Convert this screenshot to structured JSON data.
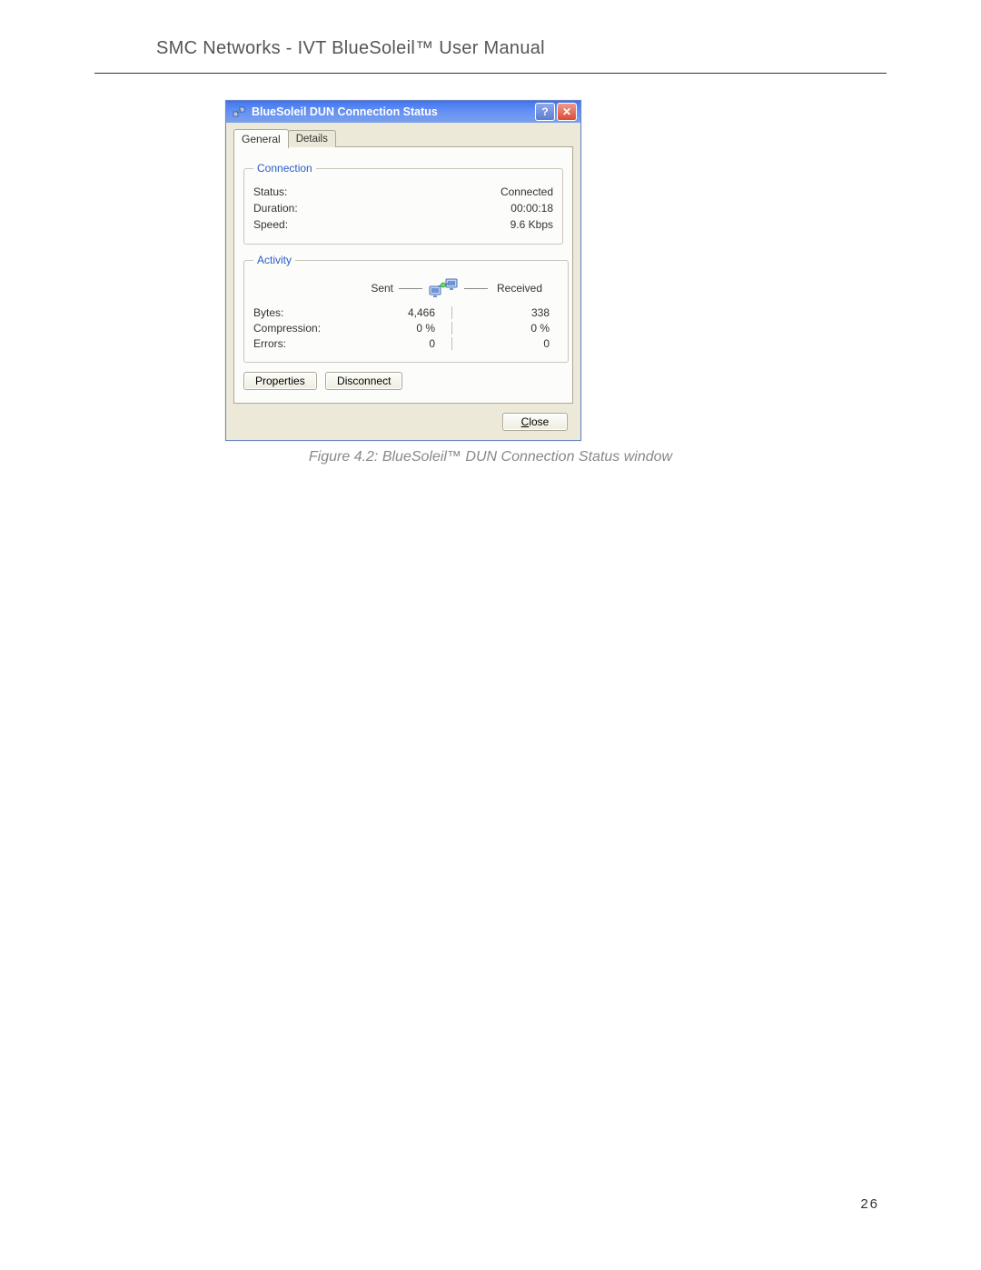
{
  "page": {
    "header_text": "SMC Networks - IVT BlueSoleil™ User Manual",
    "page_number": "26",
    "figure_caption": "Figure 4.2: BlueSoleil™ DUN Connection Status window"
  },
  "dialog": {
    "title": "BlueSoleil DUN Connection Status",
    "help_glyph": "?",
    "close_glyph": "✕",
    "tabs": {
      "general": "General",
      "details": "Details"
    },
    "connection": {
      "legend": "Connection",
      "status_label": "Status:",
      "status_value": "Connected",
      "duration_label": "Duration:",
      "duration_value": "00:00:18",
      "speed_label": "Speed:",
      "speed_value": "9.6 Kbps"
    },
    "activity": {
      "legend": "Activity",
      "sent_label": "Sent",
      "received_label": "Received",
      "bytes_label": "Bytes:",
      "bytes_sent": "4,466",
      "bytes_recv": "338",
      "compression_label": "Compression:",
      "compression_sent": "0 %",
      "compression_recv": "0 %",
      "errors_label": "Errors:",
      "errors_sent": "0",
      "errors_recv": "0"
    },
    "buttons": {
      "properties": "Properties",
      "disconnect": "Disconnect",
      "close_prefix": "C",
      "close_rest": "lose"
    }
  }
}
